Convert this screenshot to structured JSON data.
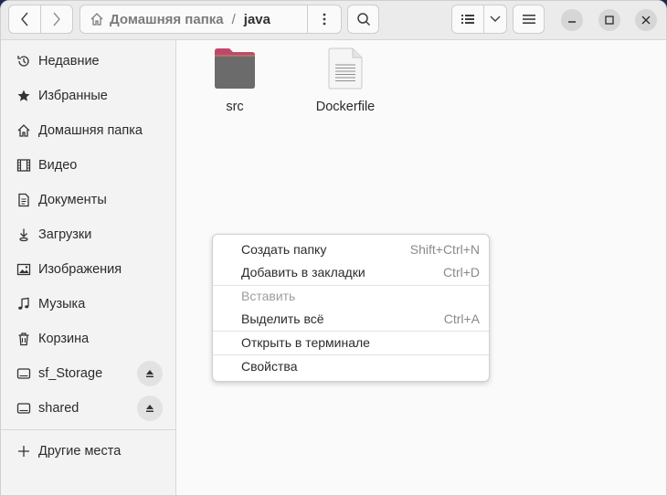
{
  "header": {
    "path_home_label": "Домашняя папка",
    "path_separator": "/",
    "path_current": "java"
  },
  "sidebar": {
    "items": [
      {
        "label": "Недавние",
        "icon": "clock-icon"
      },
      {
        "label": "Избранные",
        "icon": "star-icon"
      },
      {
        "label": "Домашняя папка",
        "icon": "home-icon"
      },
      {
        "label": "Видео",
        "icon": "film-icon"
      },
      {
        "label": "Документы",
        "icon": "document-icon"
      },
      {
        "label": "Загрузки",
        "icon": "download-icon"
      },
      {
        "label": "Изображения",
        "icon": "image-icon"
      },
      {
        "label": "Музыка",
        "icon": "music-icon"
      },
      {
        "label": "Корзина",
        "icon": "trash-icon"
      },
      {
        "label": "sf_Storage",
        "icon": "drive-icon"
      },
      {
        "label": "shared",
        "icon": "drive-icon"
      },
      {
        "label": "Другие места",
        "icon": "plus-icon"
      }
    ]
  },
  "files": [
    {
      "name": "src",
      "type": "folder"
    },
    {
      "name": "Dockerfile",
      "type": "text-file"
    }
  ],
  "context_menu": {
    "items": [
      {
        "label": "Создать папку",
        "accel": "Shift+Ctrl+N"
      },
      {
        "label": "Добавить в закладки",
        "accel": "Ctrl+D"
      },
      {
        "label": "Вставить",
        "accel": "",
        "disabled": true
      },
      {
        "label": "Выделить всё",
        "accel": "Ctrl+A"
      },
      {
        "label": "Открыть в терминале",
        "accel": ""
      },
      {
        "label": "Свойства",
        "accel": ""
      }
    ]
  },
  "colors": {
    "folder_accent": "#c1476a",
    "folder_body": "#6b6b6b",
    "window_bg": "#fafafa",
    "desktop_bg": "#1a2a55"
  }
}
